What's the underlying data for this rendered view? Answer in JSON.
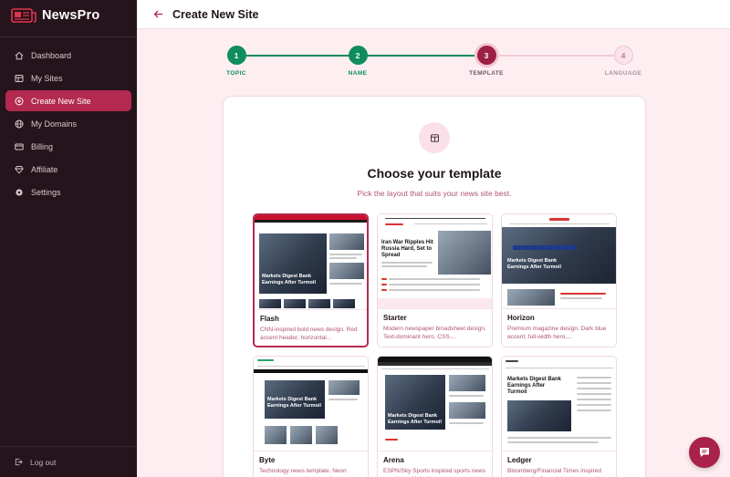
{
  "brand": {
    "name": "NewsPro"
  },
  "sidebar": {
    "items": [
      {
        "label": "Dashboard",
        "icon": "home-icon",
        "active": false
      },
      {
        "label": "My Sites",
        "icon": "sites-icon",
        "active": false
      },
      {
        "label": "Create New Site",
        "icon": "plus-circle-icon",
        "active": true
      },
      {
        "label": "My Domains",
        "icon": "globe-icon",
        "active": false
      },
      {
        "label": "Billing",
        "icon": "credit-card-icon",
        "active": false
      },
      {
        "label": "Affiliate",
        "icon": "diamond-icon",
        "active": false
      },
      {
        "label": "Settings",
        "icon": "gear-icon",
        "active": false
      }
    ],
    "logout_label": "Log out"
  },
  "header": {
    "title": "Create New Site"
  },
  "stepper": {
    "steps": [
      {
        "number": "1",
        "label": "TOPIC",
        "state": "done"
      },
      {
        "number": "2",
        "label": "NAME",
        "state": "done"
      },
      {
        "number": "3",
        "label": "TEMPLATE",
        "state": "current"
      },
      {
        "number": "4",
        "label": "LANGUAGE",
        "state": "todo"
      }
    ]
  },
  "card": {
    "title": "Choose your template",
    "subtitle": "Pick the layout that suits your news site best."
  },
  "templates": [
    {
      "name": "Flash",
      "description": "CNN-inspired bold news design. Red accent header, horizontal...",
      "selected": true,
      "preview_headline": "Markets Digest Bank Earnings After Turmoil"
    },
    {
      "name": "Starter",
      "description": "Modern newspaper broadsheet design. Text-dominant hero, CSS-...",
      "selected": false,
      "preview_headline": "Iran War Ripples Hit Russia Hard, Set to Spread"
    },
    {
      "name": "Horizon",
      "description": "Premium magazine design. Dark blue accent, full-width hero,...",
      "selected": false,
      "preview_headline": "Markets Digest Bank Earnings After Turmoil"
    },
    {
      "name": "Byte",
      "description": "Technology news template. Neon green accent, modern gradients...",
      "selected": false,
      "preview_headline": "Markets Digest Bank Earnings After Turmoil"
    },
    {
      "name": "Arena",
      "description": "ESPN/Sky Sports inspired sports news template with bold...",
      "selected": false,
      "preview_headline": "Markets Digest Bank Earnings After Turmoil"
    },
    {
      "name": "Ledger",
      "description": "Bloomberg/Financial Times inspired template for financial and economic...",
      "selected": false,
      "preview_headline": "Markets Digest Bank Earnings After Turmoil"
    }
  ],
  "colors": {
    "sidebar_bg": "#26141c",
    "accent": "#b3294f",
    "success": "#0f8d5c",
    "page_bg": "#fdeef2"
  }
}
